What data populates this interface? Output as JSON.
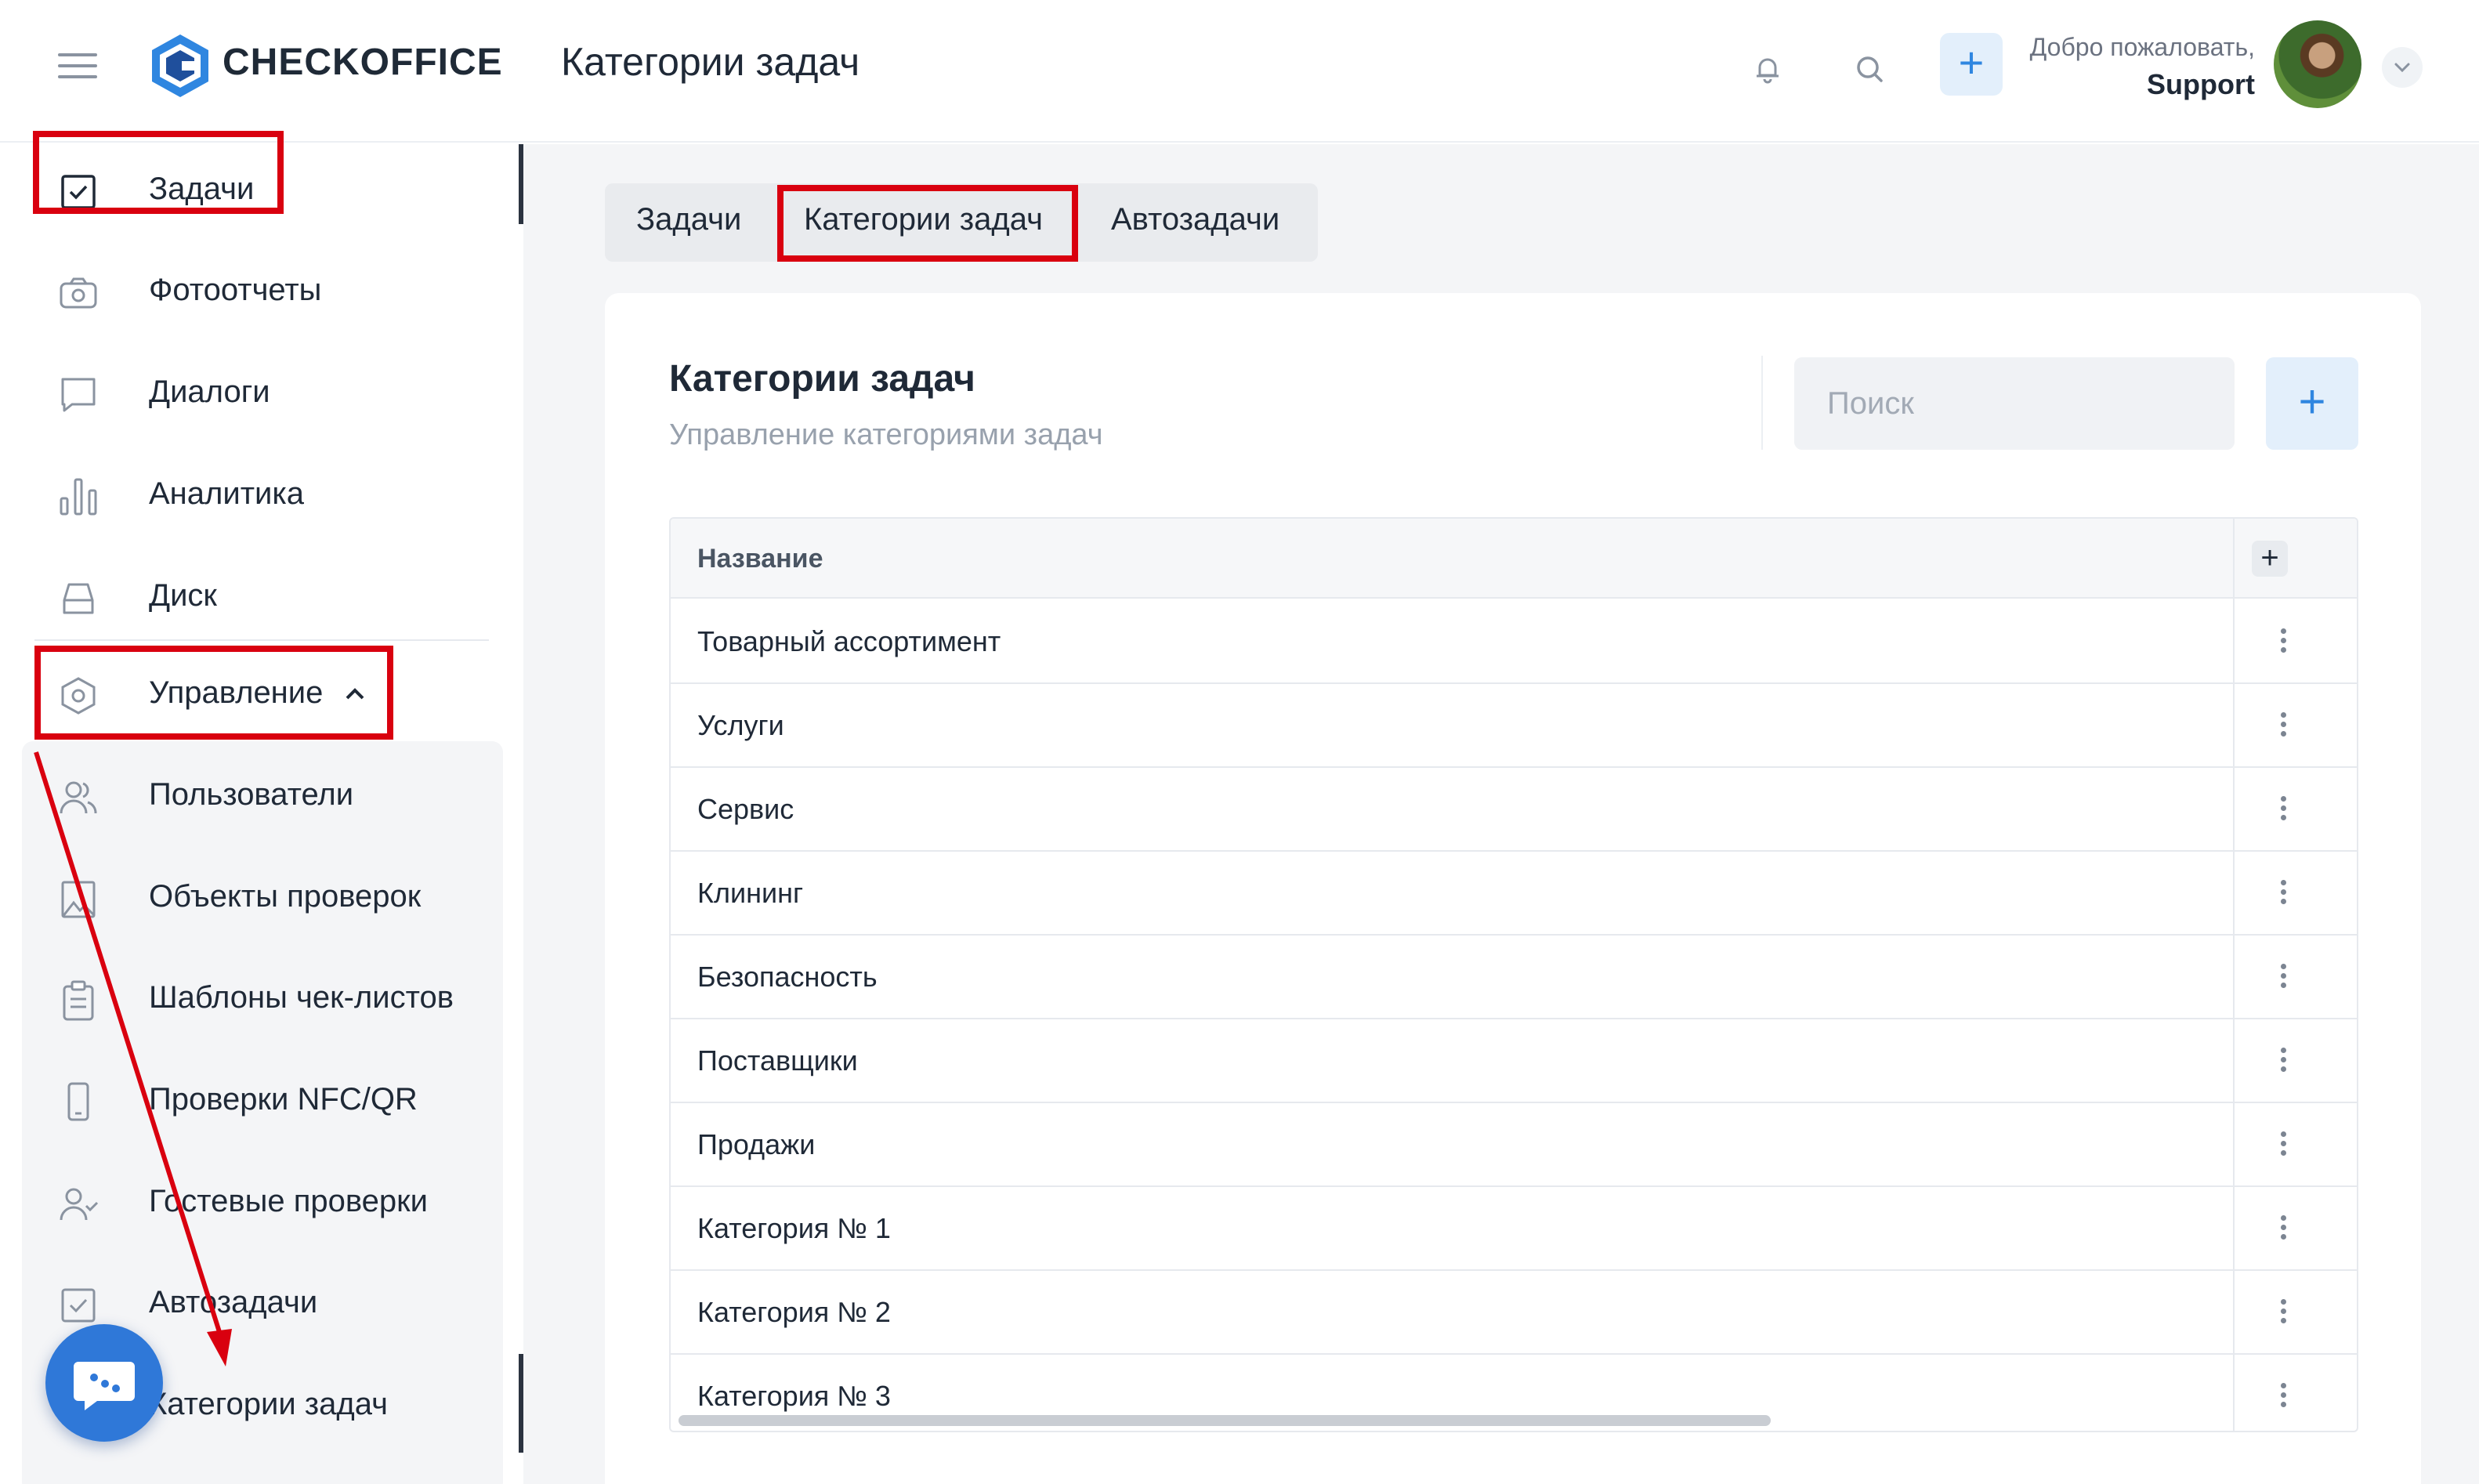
{
  "header": {
    "brand": "CHECKOFFICE",
    "page_title": "Категории задач",
    "welcome_line": "Добро пожаловать,",
    "user_name": "Support",
    "icons": [
      "menu-icon",
      "bell-icon",
      "search-icon",
      "plus-icon",
      "chevron-down-icon"
    ]
  },
  "sidebar": {
    "items": [
      {
        "label": "Задачи",
        "icon": "checkbox-icon"
      },
      {
        "label": "Фотоотчеты",
        "icon": "camera-icon"
      },
      {
        "label": "Диалоги",
        "icon": "chat-icon"
      },
      {
        "label": "Аналитика",
        "icon": "bar-chart-icon"
      },
      {
        "label": "Диск",
        "icon": "drive-icon"
      }
    ],
    "management": {
      "label": "Управление",
      "icon": "hexagon-gear-icon",
      "expanded": true
    },
    "sub_items": [
      {
        "label": "Пользователи",
        "icon": "users-icon"
      },
      {
        "label": "Объекты проверок",
        "icon": "building-icon"
      },
      {
        "label": "Шаблоны чек-листов",
        "icon": "clipboard-icon"
      },
      {
        "label": "Проверки NFC/QR",
        "icon": "phone-icon"
      },
      {
        "label": "Гостевые проверки",
        "icon": "user-check-icon"
      },
      {
        "label": "Автозадачи",
        "icon": "checkbox-icon"
      },
      {
        "label": "Категории задач",
        "icon": "tag-icon"
      }
    ]
  },
  "tabs": [
    {
      "label": "Задачи"
    },
    {
      "label": "Категории задач",
      "active": true
    },
    {
      "label": "Автозадачи"
    }
  ],
  "card": {
    "title": "Категории задач",
    "subtitle": "Управление категориями задач",
    "search_placeholder": "Поиск",
    "add_label": "+"
  },
  "table": {
    "column_name": "Название",
    "add_column_label": "+",
    "rows": [
      "Товарный ассортимент",
      "Услуги",
      "Сервис",
      "Клининг",
      "Безопасность",
      "Поставщики",
      "Продажи",
      "Категория № 1",
      "Категория № 2",
      "Категория № 3"
    ]
  },
  "colors": {
    "accent": "#2f86e0",
    "highlight_box": "#d9000f",
    "chat_button": "#2f78d8"
  }
}
